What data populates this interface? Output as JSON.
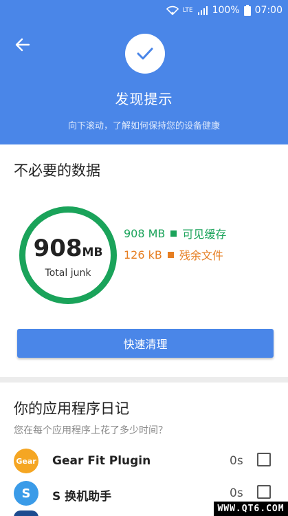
{
  "status_bar": {
    "network": "LTE",
    "battery": "100%",
    "time": "07:00"
  },
  "header": {
    "title": "发现提示",
    "subtitle": "向下滚动，了解如何保持您的设备健康"
  },
  "junk_card": {
    "title": "不必要的数据",
    "total_value": "908",
    "total_unit": "MB",
    "total_label": "Total junk",
    "legend": [
      {
        "value": "908 MB",
        "label": "可见缓存",
        "color": "#1aa35a"
      },
      {
        "value": "126 kB",
        "label": "残余文件",
        "color": "#e67e22"
      }
    ],
    "clean_button": "快速清理"
  },
  "diary_card": {
    "title": "你的应用程序日记",
    "subtitle": "您在每个应用程序上花了多少时间？",
    "apps": [
      {
        "icon_text": "Gear",
        "name": "Gear Fit Plugin",
        "time": "0s",
        "icon_color": "#f5a623"
      },
      {
        "icon_text": "S",
        "name": "S 换机助手",
        "time": "0s",
        "icon_color": "#3a9be8"
      }
    ]
  },
  "watermark": "WWW.QT6.COM",
  "colors": {
    "primary": "#4a86e8",
    "green": "#1aa35a",
    "orange": "#e67e22"
  }
}
